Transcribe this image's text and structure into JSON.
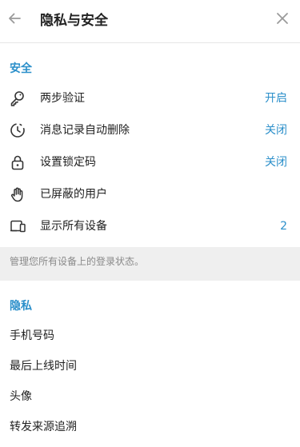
{
  "header": {
    "title": "隐私与安全",
    "back_icon": "arrow-left-icon",
    "close_icon": "close-icon"
  },
  "security": {
    "title": "安全",
    "items": [
      {
        "icon": "key-icon",
        "label": "两步验证",
        "value": "开启"
      },
      {
        "icon": "timer-icon",
        "label": "消息记录自动删除",
        "value": "关闭"
      },
      {
        "icon": "lock-icon",
        "label": "设置锁定码",
        "value": "关闭"
      },
      {
        "icon": "hand-icon",
        "label": "已屏蔽的用户",
        "value": ""
      },
      {
        "icon": "devices-icon",
        "label": "显示所有设备",
        "value": "2"
      }
    ],
    "note": "管理您所有设备上的登录状态。"
  },
  "privacy": {
    "title": "隐私",
    "items": [
      {
        "label": "手机号码"
      },
      {
        "label": "最后上线时间"
      },
      {
        "label": "头像"
      },
      {
        "label": "转发来源追溯"
      }
    ]
  },
  "colors": {
    "accent": "#2b8fca",
    "text": "#222222",
    "muted": "#8a8a8a",
    "band": "#efefef"
  }
}
